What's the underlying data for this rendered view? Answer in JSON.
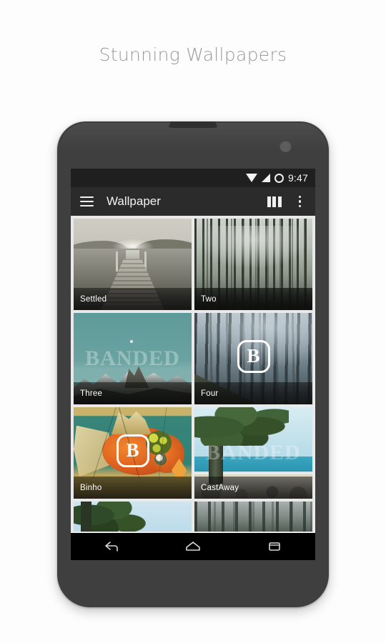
{
  "headline": "Stunning Wallpapers",
  "phone": {
    "camera_icon": "front-camera",
    "speaker_icon": "earpiece-speaker"
  },
  "status_bar": {
    "time": "9:47",
    "icons": [
      "wifi-icon",
      "cellular-signal-icon",
      "battery-icon"
    ]
  },
  "action_bar": {
    "menu_icon": "hamburger-menu-icon",
    "title": "Wallpaper",
    "columns_icon": "grid-columns-icon",
    "overflow_icon": "overflow-menu-icon"
  },
  "grid": {
    "watermark_text": "BANDED",
    "badge_letter": "B",
    "tiles": [
      {
        "label": "Settled",
        "art": "lake-dock-monochrome"
      },
      {
        "label": "Two",
        "art": "tall-forest-mist"
      },
      {
        "label": "Three",
        "art": "teal-sky-snowy-mountains"
      },
      {
        "label": "Four",
        "art": "misty-blue-forest"
      },
      {
        "label": "Binho",
        "art": "goldfish-mural"
      },
      {
        "label": "CastAway",
        "art": "beach-tree-ocean"
      },
      {
        "label": "",
        "art": "green-foliage-sky"
      },
      {
        "label": "",
        "art": "dark-misty-forest"
      }
    ]
  },
  "nav_bar": {
    "back_label": "Back",
    "home_label": "Home",
    "recents_label": "Recents"
  },
  "colors": {
    "page_bg": "#fdfdfd",
    "headline": "#9a9a9a",
    "phone_body": "#3f3f3f",
    "status_bar": "#1f1f1f",
    "action_bar": "#2b2b2b",
    "grid_gap": "#e9e9e9",
    "nav_bar": "#000000",
    "label_text": "#ffffff"
  }
}
